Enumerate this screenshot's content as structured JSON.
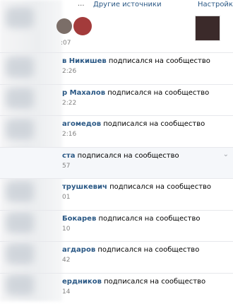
{
  "topbar": {
    "dots": "...",
    "sources_link": "Другие источники",
    "settings_link": "Настройки"
  },
  "head": {
    "time": ":07"
  },
  "items": [
    {
      "name": "в Никишев",
      "action": "подписался на сообщество",
      "time": "2:26"
    },
    {
      "name": "р Махалов",
      "action": "подписался на сообщество",
      "time": "2:22"
    },
    {
      "name": "агомедов",
      "action": "подписался на сообщество",
      "time": "2:16"
    },
    {
      "name": "ста",
      "action": "подписался на сообщество",
      "time": "57",
      "highlight": true
    },
    {
      "name": "трушкевич",
      "action": "подписался на сообщество",
      "time": "01"
    },
    {
      "name": "Бокарев",
      "action": "подписался на сообщество",
      "time": "10"
    },
    {
      "name": "агдаров",
      "action": "подписался на сообщество",
      "time": "42"
    },
    {
      "name": "ердников",
      "action": "подписался на сообщество",
      "time": "14"
    }
  ]
}
